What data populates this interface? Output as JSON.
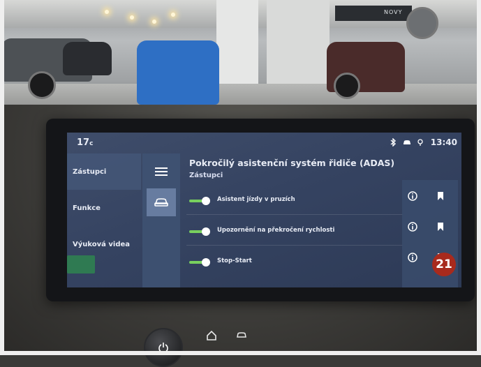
{
  "status_bar": {
    "temperature": "17",
    "temperature_unit": "c",
    "time": "13:40",
    "icons": [
      "bluetooth-icon",
      "car-icon",
      "location-icon"
    ]
  },
  "nav": {
    "items": [
      {
        "label": "Zástupci",
        "active": true
      },
      {
        "label": "Funkce",
        "active": false
      },
      {
        "label": "Výuková videa",
        "active": false
      }
    ]
  },
  "rail": {
    "items": [
      {
        "icon": "menu-icon",
        "active": false
      },
      {
        "icon": "car-icon",
        "active": true
      }
    ]
  },
  "header": {
    "title": "Pokročilý asistenční systém řidiče (ADAS)",
    "subtitle": "Zástupci"
  },
  "rows": [
    {
      "label": "Asistent jízdy v pruzích",
      "enabled": true
    },
    {
      "label": "Upozornění na překročení rychlosti",
      "enabled": true
    },
    {
      "label": "Stop-Start",
      "enabled": true
    }
  ],
  "actions": [
    "info-icon",
    "bookmark-icon"
  ],
  "badge": "21",
  "showroom_sign": "NOVY",
  "colors": {
    "screen_bg": "#354361",
    "toggle_on": "#78d05e",
    "badge": "#a82a1d"
  }
}
